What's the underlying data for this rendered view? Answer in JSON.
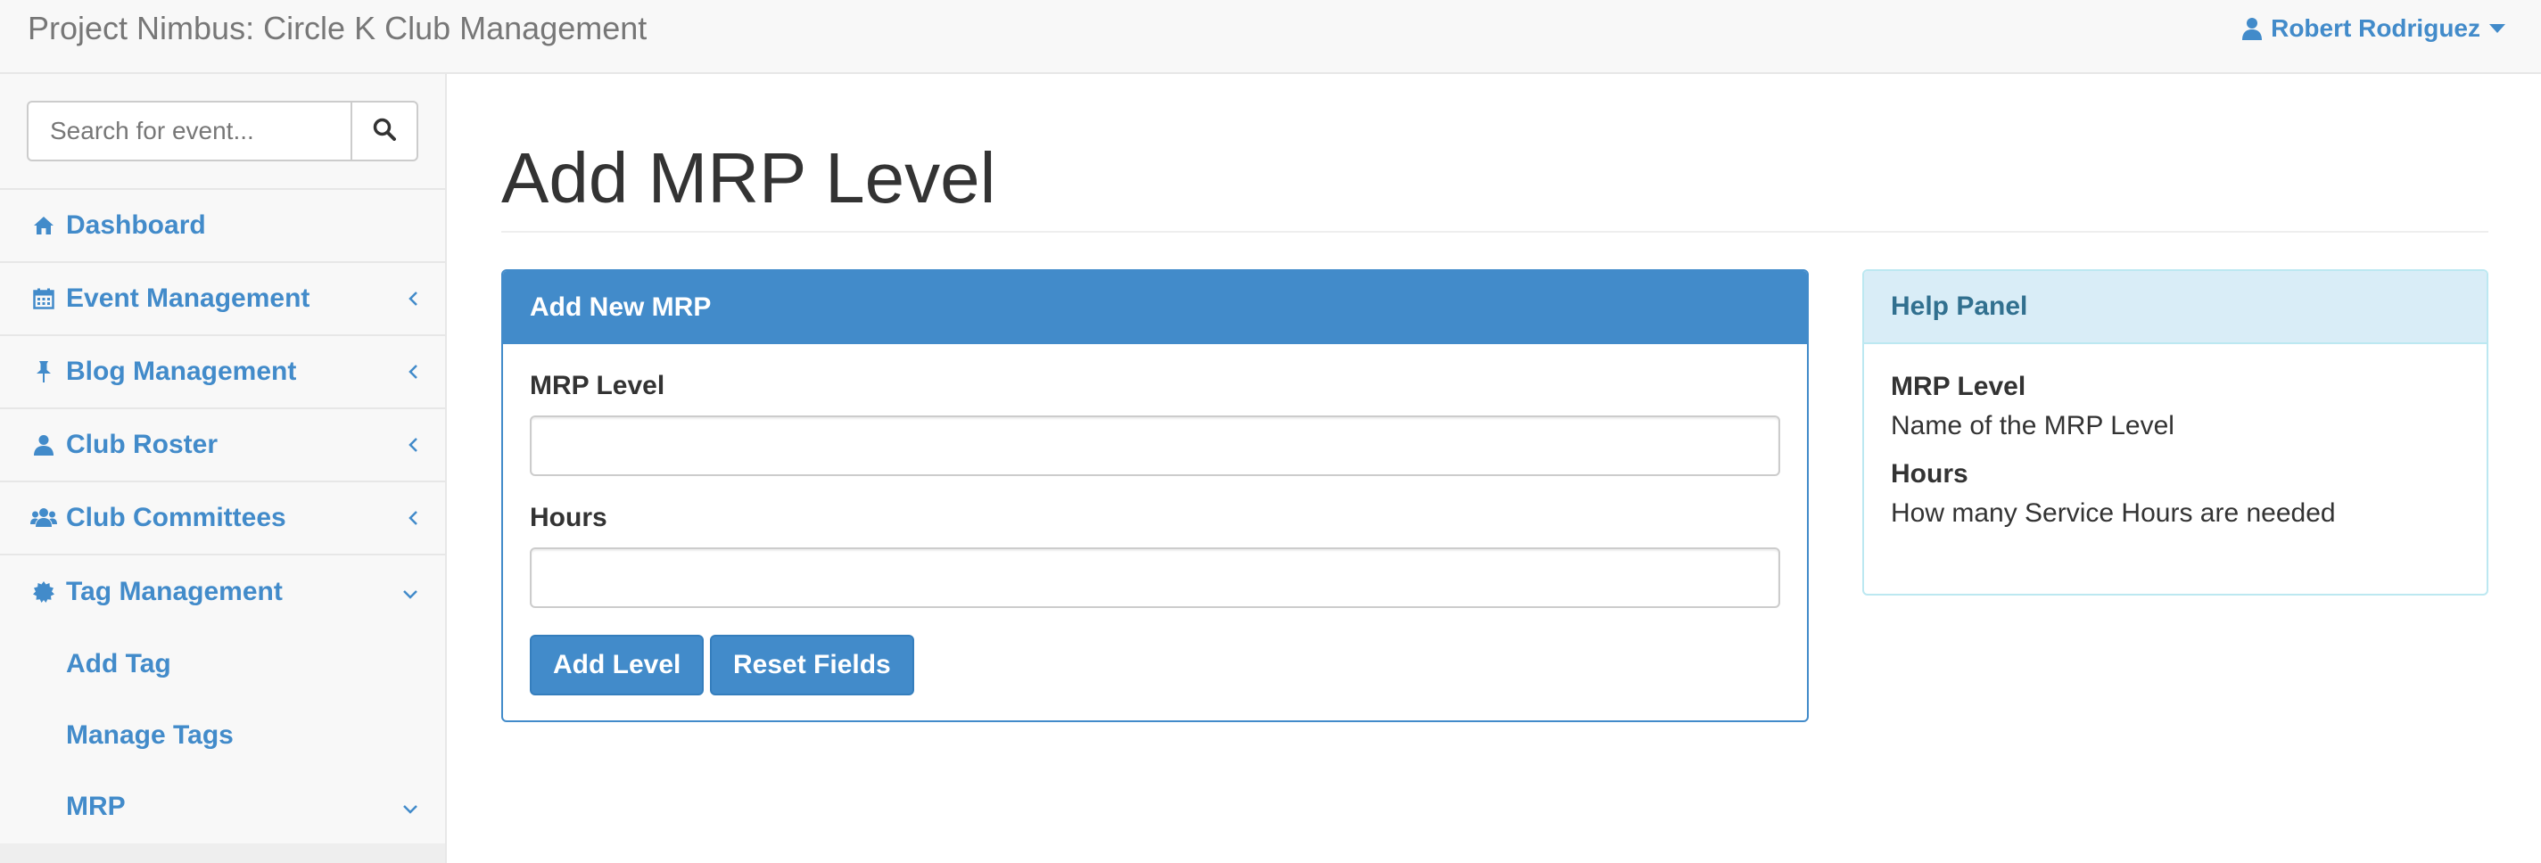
{
  "app": {
    "brand": "Project Nimbus: Circle K Club Management",
    "user_name": "Robert Rodriguez"
  },
  "sidebar": {
    "search_placeholder": "Search for event...",
    "items": [
      {
        "label": "Dashboard",
        "icon": "home-icon",
        "has_caret": false
      },
      {
        "label": "Event Management",
        "icon": "calendar-icon",
        "has_caret": true,
        "caret": "chevron-left-icon"
      },
      {
        "label": "Blog Management",
        "icon": "pushpin-icon",
        "has_caret": true,
        "caret": "chevron-left-icon"
      },
      {
        "label": "Club Roster",
        "icon": "user-icon",
        "has_caret": true,
        "caret": "chevron-left-icon"
      },
      {
        "label": "Club Committees",
        "icon": "users-icon",
        "has_caret": true,
        "caret": "chevron-left-icon"
      },
      {
        "label": "Tag Management",
        "icon": "certificate-icon",
        "has_caret": true,
        "caret": "chevron-down-icon"
      }
    ],
    "sub_items": [
      {
        "label": "Add Tag"
      },
      {
        "label": "Manage Tags"
      },
      {
        "label": "MRP",
        "caret": "chevron-down-icon"
      }
    ]
  },
  "main": {
    "page_title": "Add MRP Level",
    "form_panel": {
      "heading": "Add New MRP",
      "fields": [
        {
          "label": "MRP Level",
          "value": "",
          "placeholder": ""
        },
        {
          "label": "Hours",
          "value": "",
          "placeholder": ""
        }
      ],
      "add_button": "Add Level",
      "reset_button": "Reset Fields"
    },
    "help_panel": {
      "heading": "Help Panel",
      "entries": [
        {
          "term": "MRP Level",
          "description": "Name of the MRP Level"
        },
        {
          "term": "Hours",
          "description": "How many Service Hours are needed"
        }
      ]
    }
  },
  "colors": {
    "accent": "#428bca",
    "navbar_bg": "#f8f8f8",
    "info_heading_bg": "#d9edf7",
    "info_heading_text": "#31708f"
  }
}
